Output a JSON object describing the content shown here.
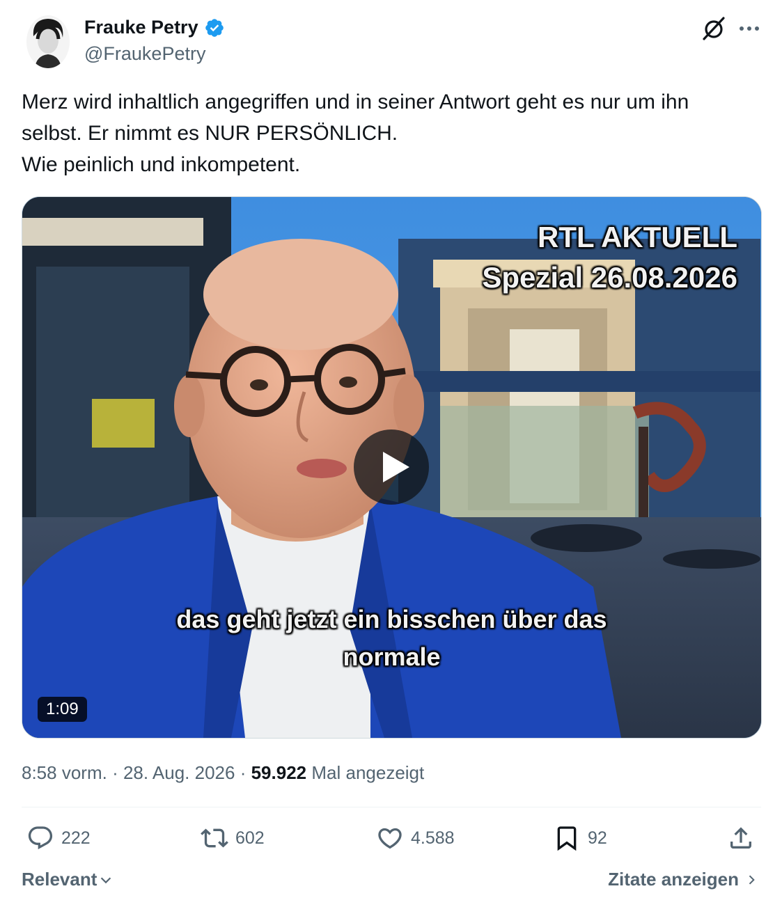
{
  "author": {
    "display_name": "Frauke Petry",
    "handle": "@FraukePetry",
    "verified": true,
    "verified_color": "#1d9bf0"
  },
  "header_icons": [
    "grok-icon",
    "more-icon"
  ],
  "tweet": {
    "lines": [
      "Merz wird inhaltlich angegriffen und in seiner Antwort geht es nur um ihn",
      "selbst. Er nimmt es NUR PERSÖNLICH.",
      "Wie peinlich und inkompetent."
    ]
  },
  "video": {
    "overlay_title": "RTL AKTUELL",
    "overlay_date": "Spezial 26.08.2026",
    "subtitle_line1": "das geht jetzt ein bisschen über das",
    "subtitle_line2": "normale",
    "duration": "1:09"
  },
  "meta": {
    "time": "8:58 vorm.",
    "separator": "·",
    "date": "28. Aug. 2026",
    "views": "59.922",
    "views_label": "Mal angezeigt"
  },
  "actions": {
    "replies": "222",
    "retweets": "602",
    "likes": "4.588",
    "bookmarks": "92"
  },
  "footer": {
    "sort_label": "Relevant",
    "quotes_label": "Zitate anzeigen"
  }
}
